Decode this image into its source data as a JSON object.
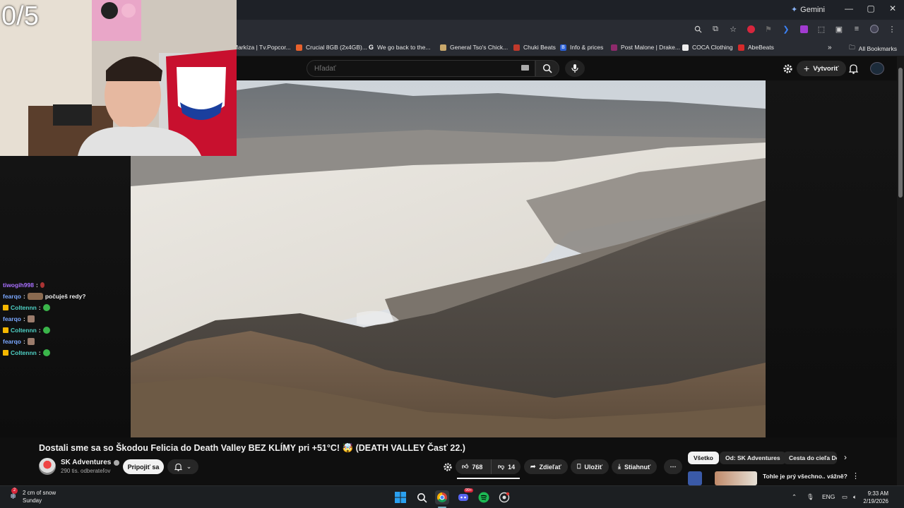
{
  "webcam": {
    "counter": "0/5"
  },
  "browser": {
    "gemini_label": "Gemini",
    "bookmarks": [
      {
        "label": "Markíza | Tv.Popcor...",
        "color": "#3a3a3a"
      },
      {
        "label": "Crucial 8GB (2x4GB)...",
        "color": "#e8612c"
      },
      {
        "label": "We go back to the...",
        "color": "#ffffff"
      },
      {
        "label": "General Tso's Chick...",
        "color": "#c9a86b"
      },
      {
        "label": "Chuki Beats",
        "color": "#c0392b"
      },
      {
        "label": "Info & prices",
        "color": "#2a5fd6"
      },
      {
        "label": "Post Malone | Drake...",
        "color": "#8e2a6b"
      },
      {
        "label": "COCA Clothing",
        "color": "#eeeeee"
      },
      {
        "label": "AbeBeats",
        "color": "#d62a2a"
      }
    ],
    "all_bookmarks": "All Bookmarks"
  },
  "youtube": {
    "search_placeholder": "Hľadať",
    "create_label": "Vytvoriť"
  },
  "chat": [
    {
      "user": "tiwogih998",
      "color": "#a970ff",
      "message": "",
      "badge": false
    },
    {
      "user": "fearqo",
      "color": "#7aa7ff",
      "message": "počuješ redy?",
      "badge": false
    },
    {
      "user": "Coltennn",
      "color": "#4fd1c5",
      "message": "",
      "badge": true
    },
    {
      "user": "fearqo",
      "color": "#7aa7ff",
      "message": "",
      "badge": false
    },
    {
      "user": "Coltennn",
      "color": "#4fd1c5",
      "message": "",
      "badge": true
    },
    {
      "user": "fearqo",
      "color": "#7aa7ff",
      "message": "",
      "badge": false
    },
    {
      "user": "Coltennn",
      "color": "#4fd1c5",
      "message": "",
      "badge": true
    }
  ],
  "video": {
    "title": "Dostali sme sa so Škodou Felicia do Death Valley BEZ KLÍMY pri +51°C! 🤯 (DEATH VALLEY Časť 22.)",
    "channel": "SK Adventures",
    "subscribers": "290 tis. odberateľov",
    "join": "Pripojiť sa",
    "likes": "768",
    "dislikes": "14",
    "share": "Zdieľať",
    "save": "Uložiť",
    "download": "Stiahnuť"
  },
  "chips": [
    "Všetko",
    "Od: SK Adventures",
    "Cesta do cieľa Do"
  ],
  "recommendation": {
    "title": "Tohle je prý všechno.. vážně?"
  },
  "taskbar": {
    "weather_title": "2 cm of snow",
    "weather_sub": "Sunday",
    "weather_badge": "2",
    "lang": "ENG",
    "time": "9:33 AM",
    "date": "2/19/2026"
  }
}
